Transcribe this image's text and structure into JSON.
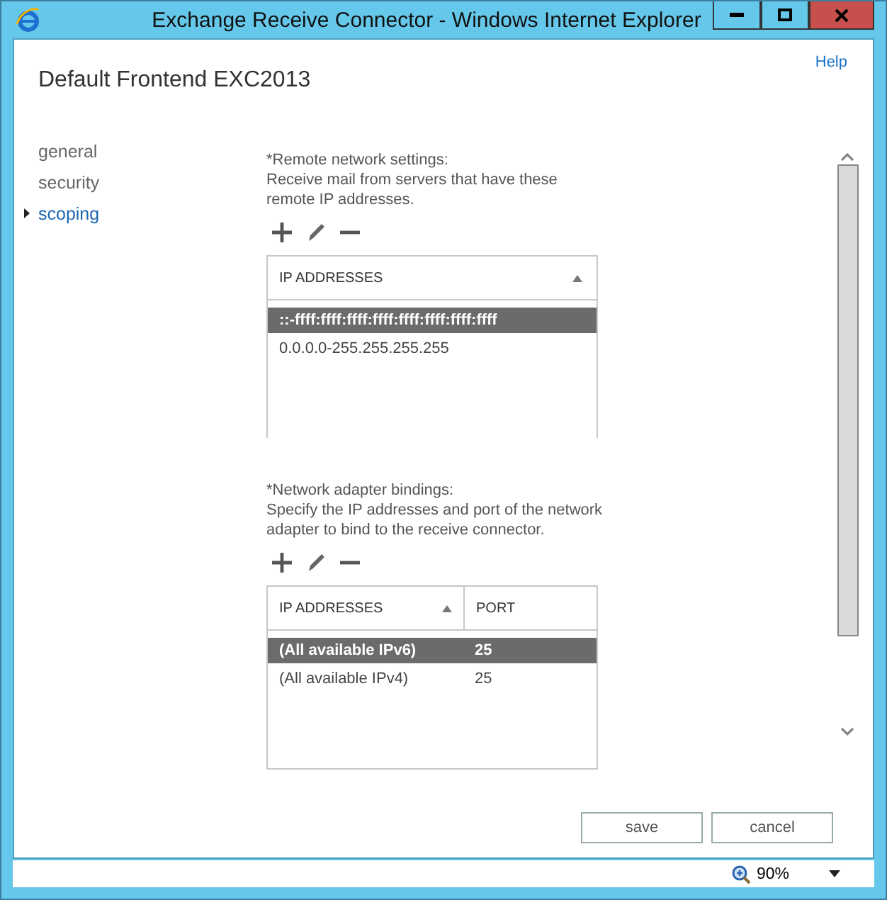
{
  "window": {
    "title": "Exchange Receive Connector - Windows Internet Explorer"
  },
  "page": {
    "title": "Default Frontend EXC2013",
    "help": "Help"
  },
  "sidebar": {
    "items": [
      {
        "label": "general",
        "selected": false
      },
      {
        "label": "security",
        "selected": false
      },
      {
        "label": "scoping",
        "selected": true
      }
    ]
  },
  "sections": [
    {
      "heading": "*Remote network settings:",
      "description": "Receive mail from servers that have these remote IP addresses.",
      "columns": [
        {
          "label": "IP ADDRESSES",
          "sorted": true
        }
      ],
      "rows": [
        {
          "cells": [
            "::-ffff:ffff:ffff:ffff:ffff:ffff:ffff:ffff"
          ],
          "selected": true
        },
        {
          "cells": [
            "0.0.0.0-255.255.255.255"
          ],
          "selected": false
        }
      ],
      "clipped": true
    },
    {
      "heading": "*Network adapter bindings:",
      "description": "Specify the IP addresses and port of the network adapter to bind to the receive connector.",
      "columns": [
        {
          "label": "IP ADDRESSES",
          "sorted": true
        },
        {
          "label": "PORT",
          "sorted": false
        }
      ],
      "rows": [
        {
          "cells": [
            "(All available IPv6)",
            "25"
          ],
          "selected": true
        },
        {
          "cells": [
            "(All available IPv4)",
            "25"
          ],
          "selected": false
        }
      ],
      "clipped": false
    }
  ],
  "buttons": [
    "save",
    "cancel"
  ],
  "status_bar": {
    "zoom": "90%"
  }
}
